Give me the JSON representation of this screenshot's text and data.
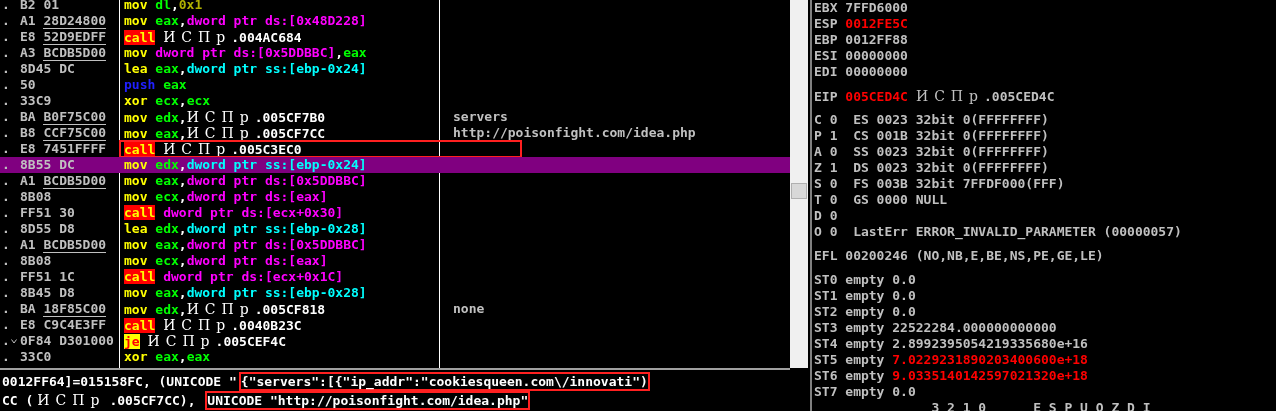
{
  "disassembly": {
    "rows": [
      {
        "marker": ".",
        "bytes": "B2",
        "operand": "01",
        "underlined": false,
        "op": {
          "text": "mov",
          "kind": "mnem"
        },
        "args": [
          {
            "text": "dl",
            "kind": "reg"
          },
          {
            "text": ",",
            "kind": "text"
          },
          {
            "text": "0x1",
            "kind": "num"
          }
        ],
        "selected": false,
        "boxed": false
      },
      {
        "marker": ".",
        "bytes": "A1",
        "operand": "28D24800",
        "underlined": true,
        "op": {
          "text": "mov",
          "kind": "mnem"
        },
        "args": [
          {
            "text": "eax",
            "kind": "reg"
          },
          {
            "text": ",",
            "kind": "text"
          },
          {
            "text": "dword ptr ds:[0x48D228]",
            "kind": "ds"
          }
        ],
        "selected": false,
        "boxed": false
      },
      {
        "marker": ".",
        "bytes": "E8",
        "operand": "52D9EDFF",
        "underlined": true,
        "op": {
          "text": "call",
          "kind": "call"
        },
        "args": [
          {
            "text": "ИСПр",
            "kind": "module"
          },
          {
            "text": ".004AC684",
            "kind": "text"
          }
        ],
        "selected": false,
        "boxed": false
      },
      {
        "marker": ".",
        "bytes": "A3",
        "operand": "BCDB5D00",
        "underlined": true,
        "op": {
          "text": "mov",
          "kind": "mnem"
        },
        "args": [
          {
            "text": "dword ptr ds:[0x5DDBBC]",
            "kind": "ds"
          },
          {
            "text": ",",
            "kind": "text"
          },
          {
            "text": "eax",
            "kind": "reg"
          }
        ],
        "selected": false,
        "boxed": false
      },
      {
        "marker": ".",
        "bytes": "8D45",
        "operand": "DC",
        "underlined": false,
        "op": {
          "text": "lea",
          "kind": "mnem"
        },
        "args": [
          {
            "text": "eax",
            "kind": "reg"
          },
          {
            "text": ",",
            "kind": "text"
          },
          {
            "text": "dword ptr ss:[ebp-0x24]",
            "kind": "ss"
          }
        ],
        "selected": false,
        "boxed": false
      },
      {
        "marker": ".",
        "bytes": "50",
        "op": {
          "text": "push",
          "kind": "stack"
        },
        "args": [
          {
            "text": "eax",
            "kind": "reg"
          }
        ],
        "selected": false,
        "boxed": false
      },
      {
        "marker": ".",
        "bytes": "33C9",
        "op": {
          "text": "xor",
          "kind": "mnem"
        },
        "args": [
          {
            "text": "ecx",
            "kind": "reg"
          },
          {
            "text": ",",
            "kind": "text"
          },
          {
            "text": "ecx",
            "kind": "reg"
          }
        ],
        "selected": false,
        "boxed": false
      },
      {
        "marker": ".",
        "bytes": "BA",
        "operand": "B0F75C00",
        "underlined": true,
        "op": {
          "text": "mov",
          "kind": "mnem"
        },
        "args": [
          {
            "text": "edx",
            "kind": "reg"
          },
          {
            "text": ",",
            "kind": "text"
          },
          {
            "text": "ИСПр",
            "kind": "module"
          },
          {
            "text": ".005CF7B0",
            "kind": "text"
          }
        ],
        "comment": "servers",
        "selected": false,
        "boxed": false
      },
      {
        "marker": ".",
        "bytes": "B8",
        "operand": "CCF75C00",
        "underlined": true,
        "op": {
          "text": "mov",
          "kind": "mnem"
        },
        "args": [
          {
            "text": "eax",
            "kind": "reg"
          },
          {
            "text": ",",
            "kind": "text"
          },
          {
            "text": "ИСПр",
            "kind": "module"
          },
          {
            "text": ".005CF7CC",
            "kind": "text"
          }
        ],
        "comment": "http://poisonfight.com/idea.php",
        "selected": false,
        "boxed": false
      },
      {
        "marker": ".",
        "bytes": "E8",
        "operand": "7451FFFF",
        "underlined": false,
        "op": {
          "text": "call",
          "kind": "call"
        },
        "args": [
          {
            "text": "ИСПр",
            "kind": "module"
          },
          {
            "text": ".005C3EC0",
            "kind": "text"
          }
        ],
        "selected": false,
        "boxed": true
      },
      {
        "marker": ".",
        "bytes": "8B55",
        "operand": "DC",
        "underlined": false,
        "op": {
          "text": "mov",
          "kind": "mnem"
        },
        "args": [
          {
            "text": "edx",
            "kind": "reg"
          },
          {
            "text": ",",
            "kind": "text"
          },
          {
            "text": "dword ptr ss:[ebp-0x24]",
            "kind": "ss"
          }
        ],
        "selected": true,
        "boxed": false
      },
      {
        "marker": ".",
        "bytes": "A1",
        "operand": "BCDB5D00",
        "underlined": true,
        "op": {
          "text": "mov",
          "kind": "mnem"
        },
        "args": [
          {
            "text": "eax",
            "kind": "reg"
          },
          {
            "text": ",",
            "kind": "text"
          },
          {
            "text": "dword ptr ds:[0x5DDBBC]",
            "kind": "ds"
          }
        ],
        "selected": false,
        "boxed": false
      },
      {
        "marker": ".",
        "bytes": "8B08",
        "op": {
          "text": "mov",
          "kind": "mnem"
        },
        "args": [
          {
            "text": "ecx",
            "kind": "reg"
          },
          {
            "text": ",",
            "kind": "text"
          },
          {
            "text": "dword ptr ds:[eax]",
            "kind": "ds"
          }
        ],
        "selected": false,
        "boxed": false
      },
      {
        "marker": ".",
        "bytes": "FF51",
        "operand": "30",
        "underlined": false,
        "op": {
          "text": "call",
          "kind": "call"
        },
        "args": [
          {
            "text": "dword ptr ds:[ecx+0x30]",
            "kind": "ds"
          }
        ],
        "selected": false,
        "boxed": false
      },
      {
        "marker": ".",
        "bytes": "8D55",
        "operand": "D8",
        "underlined": false,
        "op": {
          "text": "lea",
          "kind": "mnem"
        },
        "args": [
          {
            "text": "edx",
            "kind": "reg"
          },
          {
            "text": ",",
            "kind": "text"
          },
          {
            "text": "dword ptr ss:[ebp-0x28]",
            "kind": "ss"
          }
        ],
        "selected": false,
        "boxed": false
      },
      {
        "marker": ".",
        "bytes": "A1",
        "operand": "BCDB5D00",
        "underlined": true,
        "op": {
          "text": "mov",
          "kind": "mnem"
        },
        "args": [
          {
            "text": "eax",
            "kind": "reg"
          },
          {
            "text": ",",
            "kind": "text"
          },
          {
            "text": "dword ptr ds:[0x5DDBBC]",
            "kind": "ds"
          }
        ],
        "selected": false,
        "boxed": false
      },
      {
        "marker": ".",
        "bytes": "8B08",
        "op": {
          "text": "mov",
          "kind": "mnem"
        },
        "args": [
          {
            "text": "ecx",
            "kind": "reg"
          },
          {
            "text": ",",
            "kind": "text"
          },
          {
            "text": "dword ptr ds:[eax]",
            "kind": "ds"
          }
        ],
        "selected": false,
        "boxed": false
      },
      {
        "marker": ".",
        "bytes": "FF51",
        "operand": "1C",
        "underlined": false,
        "op": {
          "text": "call",
          "kind": "call"
        },
        "args": [
          {
            "text": "dword ptr ds:[ecx+0x1C]",
            "kind": "ds"
          }
        ],
        "selected": false,
        "boxed": false
      },
      {
        "marker": ".",
        "bytes": "8B45",
        "operand": "D8",
        "underlined": false,
        "op": {
          "text": "mov",
          "kind": "mnem"
        },
        "args": [
          {
            "text": "eax",
            "kind": "reg"
          },
          {
            "text": ",",
            "kind": "text"
          },
          {
            "text": "dword ptr ss:[ebp-0x28]",
            "kind": "ss"
          }
        ],
        "selected": false,
        "boxed": false
      },
      {
        "marker": ".",
        "bytes": "BA",
        "operand": "18F85C00",
        "underlined": true,
        "op": {
          "text": "mov",
          "kind": "mnem"
        },
        "args": [
          {
            "text": "edx",
            "kind": "reg"
          },
          {
            "text": ",",
            "kind": "text"
          },
          {
            "text": "ИСПр",
            "kind": "module"
          },
          {
            "text": ".005CF818",
            "kind": "text"
          }
        ],
        "comment": "none",
        "selected": false,
        "boxed": false
      },
      {
        "marker": ".",
        "bytes": "E8",
        "operand": "C9C4E3FF",
        "underlined": false,
        "op": {
          "text": "call",
          "kind": "call"
        },
        "args": [
          {
            "text": "ИСПр",
            "kind": "module"
          },
          {
            "text": ".0040B23C",
            "kind": "text"
          }
        ],
        "selected": false,
        "boxed": false
      },
      {
        "marker": ".",
        "jump": true,
        "bytes": "0F84",
        "operand": "D301000",
        "underlined": false,
        "op": {
          "text": "je",
          "kind": "jump"
        },
        "args": [
          {
            "text": "ИСПр",
            "kind": "module"
          },
          {
            "text": ".005CEF4C",
            "kind": "text"
          }
        ],
        "selected": false,
        "boxed": false
      },
      {
        "marker": ".",
        "bytes": "33C0",
        "op": {
          "text": "xor",
          "kind": "mnem"
        },
        "args": [
          {
            "text": "eax",
            "kind": "reg"
          },
          {
            "text": ",",
            "kind": "text"
          },
          {
            "text": "eax",
            "kind": "reg"
          }
        ],
        "selected": false,
        "boxed": false
      }
    ]
  },
  "info_pane": {
    "lines": [
      [
        {
          "text": "0012FF64]=015158FC, (UNICODE \"",
          "boxed": false
        },
        {
          "text": "{\"servers\":[{\"ip_addr\":\"cookiesqueen.com\\/innovati\")",
          "boxed": true
        }
      ],
      [
        {
          "text": "CC (",
          "boxed": false
        },
        {
          "text": "ИСПр",
          "boxed": false,
          "kind": "module"
        },
        {
          "text": ".005CF7CC), ",
          "boxed": false
        },
        {
          "text": "UNICODE \"http://poisonfight.com/idea.php\"",
          "boxed": true
        }
      ]
    ]
  },
  "registers": {
    "groups": [
      [
        [
          {
            "text": "EBX 7FFD6000",
            "kind": "text"
          }
        ],
        [
          {
            "text": "ESP ",
            "kind": "text"
          },
          {
            "text": "0012FE5C",
            "kind": "changed"
          }
        ],
        [
          {
            "text": "EBP 0012FF88",
            "kind": "text"
          }
        ],
        [
          {
            "text": "ESI 00000000",
            "kind": "text"
          }
        ],
        [
          {
            "text": "EDI 00000000",
            "kind": "text"
          }
        ]
      ],
      [
        [
          {
            "text": "EIP ",
            "kind": "text"
          },
          {
            "text": "005CED4C",
            "kind": "changed"
          },
          {
            "text": "ИСПр",
            "kind": "module"
          },
          {
            "text": ".005CED4C",
            "kind": "text"
          }
        ]
      ],
      [
        [
          {
            "text": "C 0  ES 0023 32bit 0(FFFFFFFF)",
            "kind": "text"
          }
        ],
        [
          {
            "text": "P 1  CS 001B 32bit 0(FFFFFFFF)",
            "kind": "text"
          }
        ],
        [
          {
            "text": "A 0  SS 0023 32bit 0(FFFFFFFF)",
            "kind": "text"
          }
        ],
        [
          {
            "text": "Z 1  DS 0023 32bit 0(FFFFFFFF)",
            "kind": "text"
          }
        ],
        [
          {
            "text": "S 0  FS 003B 32bit 7FFDF000(FFF)",
            "kind": "text"
          }
        ],
        [
          {
            "text": "T 0  GS 0000 NULL",
            "kind": "text"
          }
        ],
        [
          {
            "text": "D 0",
            "kind": "text"
          }
        ],
        [
          {
            "text": "O 0  LastErr ERROR_INVALID_PARAMETER (00000057)",
            "kind": "text"
          }
        ]
      ],
      [
        [
          {
            "text": "EFL 00200246 (NO,NB,E,BE,NS,PE,GE,LE)",
            "kind": "text"
          }
        ]
      ],
      [
        [
          {
            "text": "ST0 empty 0.0",
            "kind": "text"
          }
        ],
        [
          {
            "text": "ST1 empty 0.0",
            "kind": "text"
          }
        ],
        [
          {
            "text": "ST2 empty 0.0",
            "kind": "text"
          }
        ],
        [
          {
            "text": "ST3 empty 22522284.000000000000",
            "kind": "text"
          }
        ],
        [
          {
            "text": "ST4 empty 2.8992395054219335680e+16",
            "kind": "text"
          }
        ],
        [
          {
            "text": "ST5 empty ",
            "kind": "text"
          },
          {
            "text": "7.0229231890203400600e+18",
            "kind": "changed"
          }
        ],
        [
          {
            "text": "ST6 empty ",
            "kind": "text"
          },
          {
            "text": "9.0335140142597021320e+18",
            "kind": "changed"
          }
        ],
        [
          {
            "text": "ST7 empty 0.0",
            "kind": "text"
          }
        ],
        [
          {
            "text": "               3 2 1 0      E S P U O Z D I",
            "kind": "text"
          }
        ]
      ]
    ]
  }
}
